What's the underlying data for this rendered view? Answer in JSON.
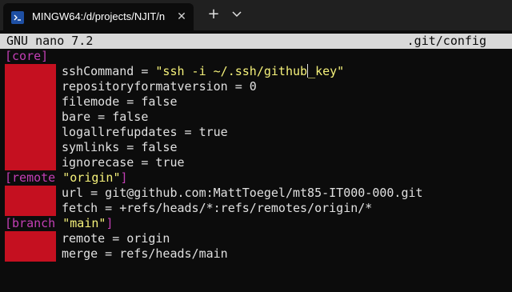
{
  "titlebar": {
    "tab_title": "MINGW64:/d/projects/NJIT/n",
    "tab_close": "✕",
    "new_tab": "+",
    "icon": "terminal-icon"
  },
  "nano": {
    "version": "GNU nano 7.2",
    "filename": ".git/config"
  },
  "config": {
    "core": {
      "header": "[core]",
      "ssh_key": "sshCommand",
      "eq": " = ",
      "ssh_val_a": "\"ssh -i ~/.ssh/github",
      "ssh_val_b": "_key\"",
      "repo": "repositoryformatversion = 0",
      "filemode": "filemode = false",
      "bare": "bare = false",
      "logall": "logallrefupdates = true",
      "symlinks": "symlinks = false",
      "ignorecase": "ignorecase = true"
    },
    "remote": {
      "header": "[remote ",
      "name": "\"origin\"",
      "close": "]",
      "url": "url = git@github.com:MattToegel/mt85-IT000-000.git",
      "fetch": "fetch = +refs/heads/*:refs/remotes/origin/*"
    },
    "branch": {
      "header": "[branch ",
      "name": "\"main\"",
      "close": "]",
      "remote": "remote = origin",
      "merge": "merge = refs/heads/main"
    }
  },
  "colors": {
    "section": "#c33fb5",
    "string": "#f5f17a",
    "text": "#e0e0e0",
    "redaction": "#c51020"
  }
}
